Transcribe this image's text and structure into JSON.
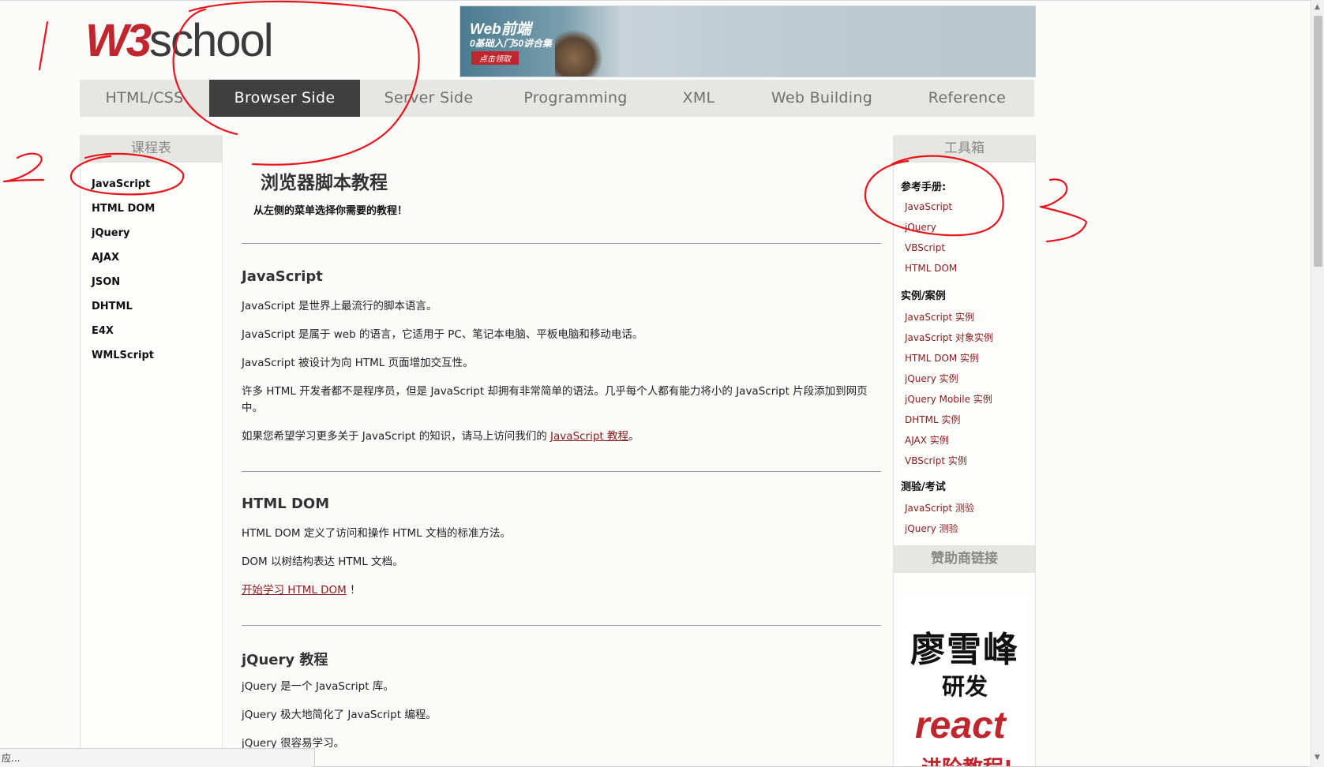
{
  "logo": {
    "w3": "W3",
    "school": "school"
  },
  "banner": {
    "title": "Web前端",
    "subtitle": "0基础入门50讲合集",
    "cta": "点击领取"
  },
  "nav": {
    "items": [
      {
        "label": "HTML/CSS",
        "active": false
      },
      {
        "label": "Browser Side",
        "active": true
      },
      {
        "label": "Server Side",
        "active": false
      },
      {
        "label": "Programming",
        "active": false
      },
      {
        "label": "XML",
        "active": false
      },
      {
        "label": "Web Building",
        "active": false
      },
      {
        "label": "Reference",
        "active": false
      }
    ]
  },
  "left_sidebar": {
    "heading": "课程表",
    "items": [
      "JavaScript",
      "HTML DOM",
      "jQuery",
      "AJAX",
      "JSON",
      "DHTML",
      "E4X",
      "WMLScript"
    ]
  },
  "main": {
    "title": "浏览器脚本教程",
    "intro": "从左侧的菜单选择你需要的教程！",
    "sections": [
      {
        "title": "JavaScript",
        "paras": [
          "JavaScript 是世界上最流行的脚本语言。",
          "JavaScript 是属于 web 的语言，它适用于 PC、笔记本电脑、平板电脑和移动电话。",
          "JavaScript 被设计为向 HTML 页面增加交互性。",
          "许多 HTML 开发者都不是程序员，但是 JavaScript 却拥有非常简单的语法。几乎每个人都有能力将小的 JavaScript 片段添加到网页中。"
        ],
        "more_prefix": "如果您希望学习更多关于 JavaScript 的知识，请马上访问我们的 ",
        "more_link": "JavaScript 教程",
        "more_suffix": "。"
      },
      {
        "title": "HTML DOM",
        "paras": [
          "HTML DOM 定义了访问和操作 HTML 文档的标准方法。",
          "DOM 以树结构表达 HTML 文档。"
        ],
        "start_link": "开始学习 HTML DOM",
        "start_suffix": " ！"
      },
      {
        "title": "jQuery 教程",
        "paras": [
          "jQuery 是一个 JavaScript 库。",
          "jQuery 极大地简化了 JavaScript 编程。",
          "jQuery 很容易学习。"
        ]
      }
    ]
  },
  "right_sidebar": {
    "heading": "工具箱",
    "groups": [
      {
        "title": "参考手册:",
        "links": [
          "JavaScript",
          "jQuery",
          "VBScript",
          "HTML DOM"
        ]
      },
      {
        "title": "实例/案例",
        "links": [
          "JavaScript 实例",
          "JavaScript 对象实例",
          "HTML DOM 实例",
          "jQuery 实例",
          "jQuery Mobile 实例",
          "DHTML 实例",
          "AJAX 实例",
          "VBScript 实例"
        ]
      },
      {
        "title": "测验/考试",
        "links": [
          "JavaScript 测验",
          "jQuery 测验"
        ]
      }
    ],
    "sponsor_heading": "赞助商链接",
    "ad": {
      "line1": "廖雪峰",
      "line2": "研发",
      "line3": "react",
      "line4": "进阶教程!"
    }
  },
  "status_bar": {
    "text": "应..."
  },
  "colors": {
    "brand_red": "#c0262d",
    "nav_active": "#3f3f3f",
    "link": "#8a1a1a",
    "annotation": "#e8151b"
  }
}
